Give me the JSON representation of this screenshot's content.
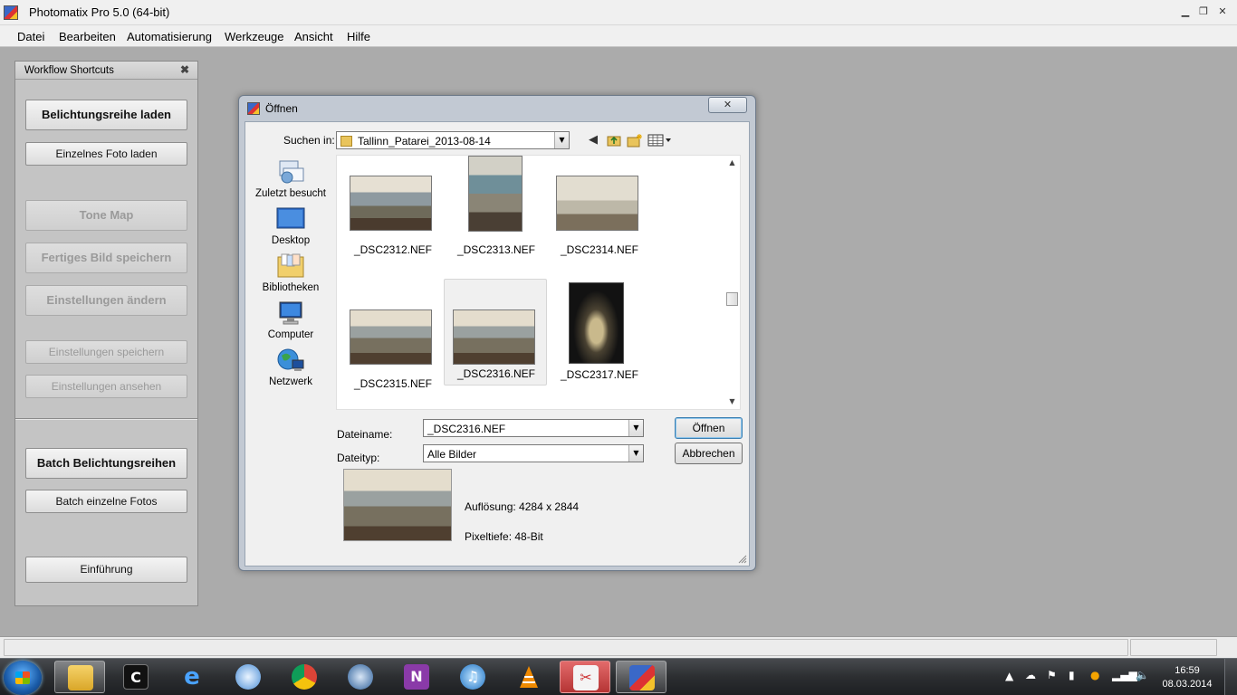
{
  "window": {
    "title": "Photomatix Pro 5.0 (64-bit)",
    "controls": {
      "minimize": "▁",
      "maximize": "❐",
      "close": "✕"
    }
  },
  "menu": [
    "Datei",
    "Bearbeiten",
    "Automatisierung",
    "Werkzeuge",
    "Ansicht",
    "Hilfe"
  ],
  "workflow": {
    "title": "Workflow Shortcuts",
    "close": "✖",
    "buttons": [
      {
        "label": "Belichtungsreihe laden",
        "enabled": true
      },
      {
        "label": "Einzelnes Foto laden",
        "enabled": true
      },
      {
        "label": "Tone Map",
        "enabled": false
      },
      {
        "label": "Fertiges Bild speichern",
        "enabled": false
      },
      {
        "label": "Einstellungen ändern",
        "enabled": false
      },
      {
        "label": "Einstellungen speichern",
        "enabled": false
      },
      {
        "label": "Einstellungen ansehen",
        "enabled": false
      },
      {
        "label": "Batch Belichtungsreihen",
        "enabled": true
      },
      {
        "label": "Batch einzelne Fotos",
        "enabled": true
      },
      {
        "label": "Einführung",
        "enabled": true
      }
    ]
  },
  "dialog": {
    "title": "Öffnen",
    "close": "✕",
    "look_in_label": "Suchen in:",
    "look_in_value": "Tallinn_Patarei_2013-08-14",
    "places": [
      "Zuletzt besucht",
      "Desktop",
      "Bibliotheken",
      "Computer",
      "Netzwerk"
    ],
    "files": [
      {
        "name": "_DSC2312.NEF",
        "selected": false,
        "orientation": "landscape"
      },
      {
        "name": "_DSC2313.NEF",
        "selected": false,
        "orientation": "portrait"
      },
      {
        "name": "_DSC2314.NEF",
        "selected": false,
        "orientation": "landscape"
      },
      {
        "name": "_DSC2315.NEF",
        "selected": false,
        "orientation": "landscape"
      },
      {
        "name": "_DSC2316.NEF",
        "selected": true,
        "orientation": "landscape"
      },
      {
        "name": "_DSC2317.NEF",
        "selected": false,
        "orientation": "portrait"
      }
    ],
    "filename_label": "Dateiname:",
    "filename_value": "_DSC2316.NEF",
    "filetype_label": "Dateityp:",
    "filetype_value": "Alle Bilder",
    "open_button": "Öffnen",
    "cancel_button": "Abbrechen",
    "resolution_text": "Auflösung: 4284 x 2844",
    "bit_depth_text": "Pixeltiefe: 48-Bit"
  },
  "taskbar": {
    "apps": [
      "explorer",
      "app-c",
      "internet-explorer",
      "safari",
      "chrome",
      "thunderbird",
      "onenote",
      "itunes",
      "vlc",
      "photomatix-red",
      "photomatix"
    ],
    "clock_time": "16:59",
    "clock_date": "08.03.2014"
  }
}
